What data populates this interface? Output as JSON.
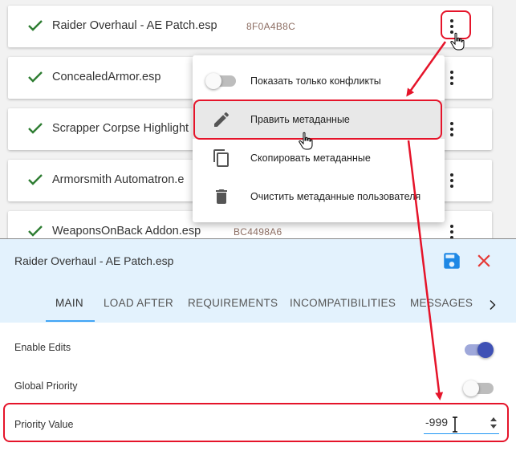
{
  "plugins": [
    {
      "name": "Raider Overhaul - AE Patch.esp",
      "crc": "8F0A4B8C"
    },
    {
      "name": "ConcealedArmor.esp",
      "crc": ""
    },
    {
      "name": "Scrapper Corpse Highlight",
      "crc": ""
    },
    {
      "name": "Armorsmith Automatron.e",
      "crc": ""
    },
    {
      "name": "WeaponsOnBack Addon.esp",
      "crc": "BC4498A6"
    }
  ],
  "menu": {
    "show_conflicts_label": "Показать только конфликты",
    "show_conflicts_on": false,
    "items": [
      {
        "label": "Править метаданные",
        "icon": "pencil-icon"
      },
      {
        "label": "Скопировать метаданные",
        "icon": "copy-icon"
      },
      {
        "label": "Очистить метаданные пользователя",
        "icon": "trash-icon"
      }
    ]
  },
  "editor": {
    "title": "Raider Overhaul - AE Patch.esp",
    "tabs": [
      "MAIN",
      "LOAD AFTER",
      "REQUIREMENTS",
      "INCOMPATIBILITIES",
      "MESSAGES"
    ],
    "active_tab": "MAIN",
    "fields": {
      "enable_edits_label": "Enable Edits",
      "enable_edits_on": true,
      "global_priority_label": "Global Priority",
      "global_priority_on": false,
      "priority_value_label": "Priority Value",
      "priority_value": "-999"
    }
  },
  "colors": {
    "check": "#2e7d32",
    "accent": "#3f51b5",
    "save": "#1e88e5",
    "close": "#e53935",
    "annotation": "#e5142a"
  }
}
